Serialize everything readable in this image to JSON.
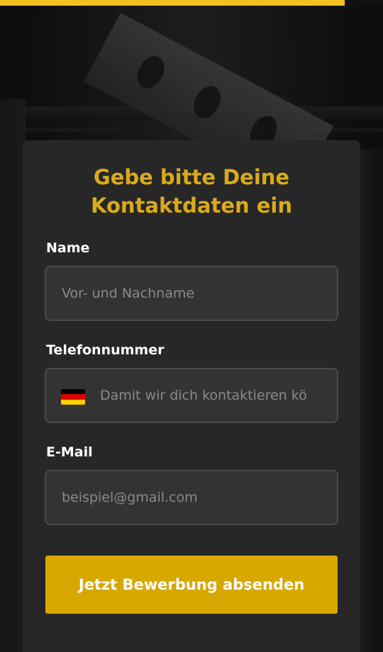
{
  "progress": {
    "fraction": 0.9,
    "color": "#f2c121"
  },
  "form": {
    "title_line1": "Gebe bitte Deine",
    "title_line2": "Kontaktdaten ein",
    "name": {
      "label": "Name",
      "placeholder": "Vor- und Nachname",
      "value": ""
    },
    "phone": {
      "label": "Telefonnummer",
      "placeholder": "Damit wir dich kontaktieren kö",
      "value": "",
      "flag_icon": "germany-flag-icon"
    },
    "email": {
      "label": "E-Mail",
      "placeholder": "beispiel@gmail.com",
      "value": ""
    },
    "submit_label": "Jetzt Bewerbung absenden"
  },
  "colors": {
    "accent": "#d6a800",
    "title": "#d9ab1a",
    "card": "#272727"
  }
}
